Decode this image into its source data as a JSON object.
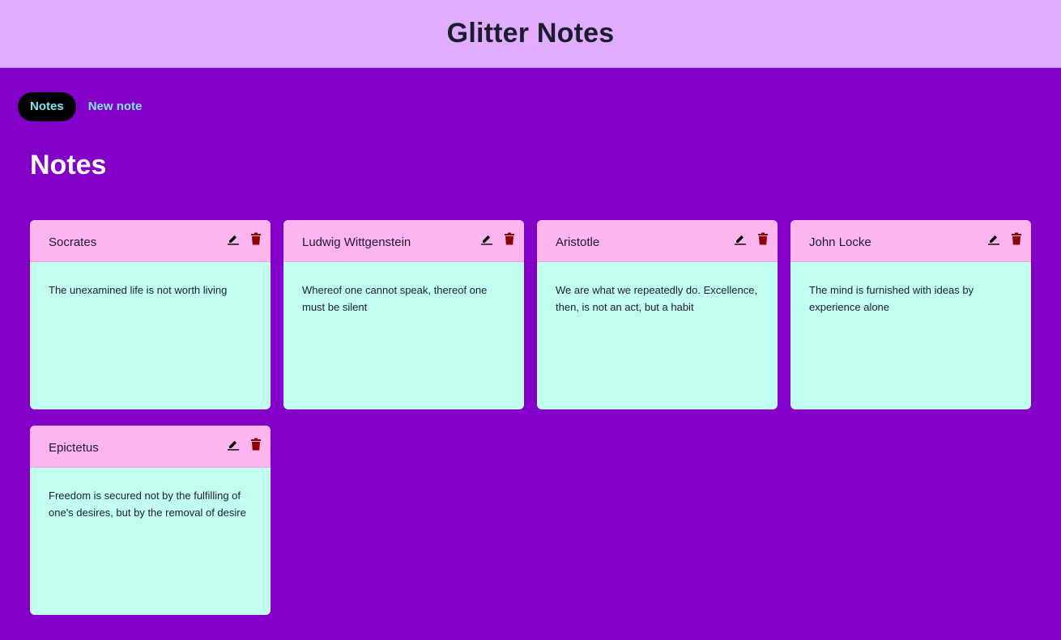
{
  "app": {
    "title": "Glitter Notes"
  },
  "nav": {
    "items": [
      {
        "label": "Notes",
        "active": true
      },
      {
        "label": "New note",
        "active": false
      }
    ]
  },
  "page": {
    "heading": "Notes"
  },
  "notes": [
    {
      "title": "Socrates",
      "body": "The unexamined life is not worth living"
    },
    {
      "title": "Ludwig Wittgenstein",
      "body": "Whereof one cannot speak, thereof one must be silent"
    },
    {
      "title": "Aristotle",
      "body": "We are what we repeatedly do. Excellence, then, is not an act, but a habit"
    },
    {
      "title": "John Locke",
      "body": "The mind is furnished with ideas by experience alone"
    },
    {
      "title": "Epictetus",
      "body": "Freedom is secured not by the fulfilling of one's desires, but by the removal of desire"
    }
  ],
  "icons": {
    "edit": "pencil-icon",
    "delete": "trash-icon"
  },
  "colors": {
    "background": "#8200c8",
    "header": "#e0acfd",
    "card_header": "#fdb5ef",
    "card_body": "#c1fff0",
    "nav_text": "#7ee6ee",
    "delete_icon": "#8b0000"
  }
}
